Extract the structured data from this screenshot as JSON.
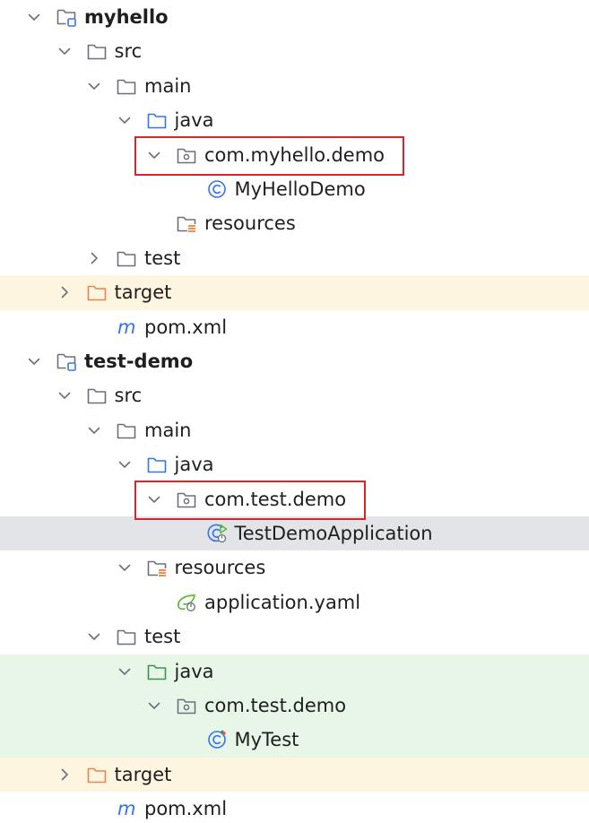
{
  "tree": {
    "nodes": [
      {
        "label": "myhello",
        "bold": true,
        "depth": 0,
        "arrow": "down",
        "icon": "module-icon",
        "highlight": ""
      },
      {
        "label": "src",
        "bold": false,
        "depth": 1,
        "arrow": "down",
        "icon": "folder-icon",
        "highlight": ""
      },
      {
        "label": "main",
        "bold": false,
        "depth": 2,
        "arrow": "down",
        "icon": "folder-icon",
        "highlight": ""
      },
      {
        "label": "java",
        "bold": false,
        "depth": 3,
        "arrow": "down",
        "icon": "source-folder-icon",
        "highlight": ""
      },
      {
        "label": "com.myhello.demo",
        "bold": false,
        "depth": 4,
        "arrow": "down",
        "icon": "package-icon",
        "highlight": ""
      },
      {
        "label": "MyHelloDemo",
        "bold": false,
        "depth": 5,
        "arrow": "none",
        "icon": "class-icon",
        "highlight": ""
      },
      {
        "label": "resources",
        "bold": false,
        "depth": 4,
        "arrow": "none",
        "icon": "resources-folder-icon",
        "highlight": ""
      },
      {
        "label": "test",
        "bold": false,
        "depth": 2,
        "arrow": "right",
        "icon": "folder-icon",
        "highlight": ""
      },
      {
        "label": "target",
        "bold": false,
        "depth": 1,
        "arrow": "right",
        "icon": "excluded-folder-icon",
        "highlight": "yellow"
      },
      {
        "label": "pom.xml",
        "bold": false,
        "depth": 2,
        "arrow": "none",
        "icon": "maven-icon",
        "highlight": ""
      },
      {
        "label": "test-demo",
        "bold": true,
        "depth": 0,
        "arrow": "down",
        "icon": "module-icon",
        "highlight": ""
      },
      {
        "label": "src",
        "bold": false,
        "depth": 1,
        "arrow": "down",
        "icon": "folder-icon",
        "highlight": ""
      },
      {
        "label": "main",
        "bold": false,
        "depth": 2,
        "arrow": "down",
        "icon": "folder-icon",
        "highlight": ""
      },
      {
        "label": "java",
        "bold": false,
        "depth": 3,
        "arrow": "down",
        "icon": "source-folder-icon",
        "highlight": ""
      },
      {
        "label": "com.test.demo",
        "bold": false,
        "depth": 4,
        "arrow": "down",
        "icon": "package-icon",
        "highlight": ""
      },
      {
        "label": "TestDemoApplication",
        "bold": false,
        "depth": 5,
        "arrow": "none",
        "icon": "spring-boot-class-icon",
        "highlight": "gray"
      },
      {
        "label": "resources",
        "bold": false,
        "depth": 3,
        "arrow": "down",
        "icon": "resources-folder-icon",
        "highlight": ""
      },
      {
        "label": "application.yaml",
        "bold": false,
        "depth": 4,
        "arrow": "none",
        "icon": "spring-config-icon",
        "highlight": ""
      },
      {
        "label": "test",
        "bold": false,
        "depth": 2,
        "arrow": "down",
        "icon": "folder-icon",
        "highlight": ""
      },
      {
        "label": "java",
        "bold": false,
        "depth": 3,
        "arrow": "down",
        "icon": "test-source-folder-icon",
        "highlight": "green"
      },
      {
        "label": "com.test.demo",
        "bold": false,
        "depth": 4,
        "arrow": "down",
        "icon": "package-icon",
        "highlight": "green"
      },
      {
        "label": "MyTest",
        "bold": false,
        "depth": 5,
        "arrow": "none",
        "icon": "test-class-icon",
        "highlight": "green"
      },
      {
        "label": "target",
        "bold": false,
        "depth": 1,
        "arrow": "right",
        "icon": "excluded-folder-icon",
        "highlight": "yellow"
      },
      {
        "label": "pom.xml",
        "bold": false,
        "depth": 2,
        "arrow": "none",
        "icon": "maven-icon",
        "highlight": ""
      }
    ],
    "annotations": [
      {
        "name": "annotation-box-com-myhello-demo",
        "node": 4
      },
      {
        "name": "annotation-box-com-test-demo",
        "node": 14
      }
    ]
  },
  "colors": {
    "folder": "#6c707e",
    "source_folder": "#3574f0",
    "test_source_folder": "#369650",
    "excluded_folder": "#e08855",
    "resources_marker": "#e66d17",
    "class_icon": "#3574f0",
    "spring": "#5fb832",
    "maven": "#3574f0",
    "annotation_box": "#d9242c",
    "highlight_yellow": "#fdf5df",
    "highlight_green": "#e8f6e8",
    "highlight_gray": "#e3e4e7"
  }
}
